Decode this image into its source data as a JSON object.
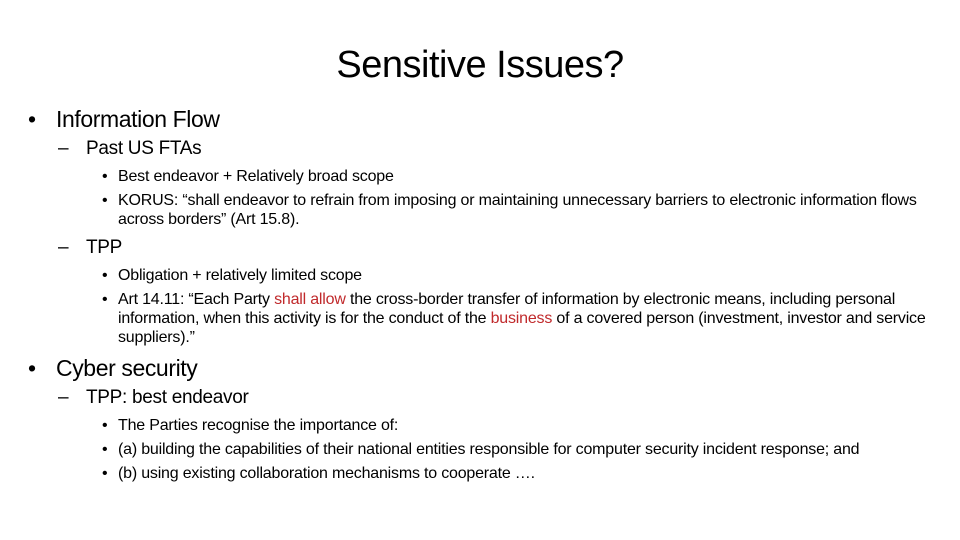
{
  "slide": {
    "title": "Sensitive Issues?",
    "sections": [
      {
        "heading": "Information Flow",
        "subsections": [
          {
            "heading": "Past US FTAs",
            "points": [
              {
                "text": "Best endeavor + Relatively broad scope"
              },
              {
                "text": "KORUS: “shall endeavor to refrain from imposing or maintaining unnecessary barriers to electronic information flows across borders” (Art 15.8)."
              }
            ]
          },
          {
            "heading": "TPP",
            "points": [
              {
                "text": "Obligation + relatively limited scope"
              },
              {
                "part1": "Art 14.11: “Each Party ",
                "highlight1": "shall allow",
                "part2": " the cross-border transfer of information by electronic means, including personal information, when this activity is for the conduct of the ",
                "highlight2": "business",
                "part3": " of a covered person (investment, investor and service suppliers).”"
              }
            ]
          }
        ]
      },
      {
        "heading": "Cyber security",
        "subsections": [
          {
            "heading": "TPP: best endeavor",
            "points": [
              {
                "text": "The Parties recognise the importance of:"
              },
              {
                "text": "(a) building the capabilities of their national entities responsible for computer security incident response; and"
              },
              {
                "text": "(b) using existing collaboration mechanisms to cooperate …."
              }
            ]
          }
        ]
      }
    ],
    "bullets": {
      "level1": "•",
      "level2": "–",
      "level3": "•"
    },
    "colors": {
      "highlight": "#c0292b",
      "text": "#000000"
    }
  }
}
